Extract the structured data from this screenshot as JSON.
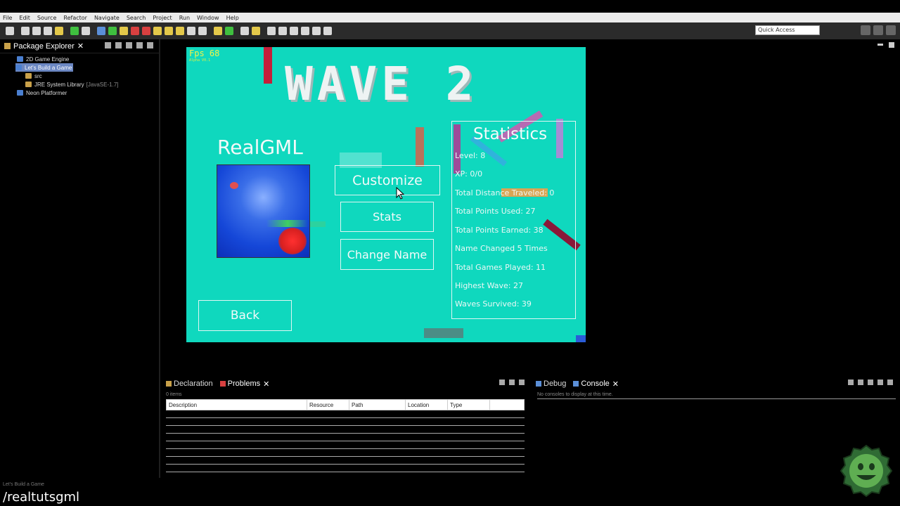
{
  "menubar": {
    "items": [
      "File",
      "Edit",
      "Source",
      "Refactor",
      "Navigate",
      "Search",
      "Project",
      "Run",
      "Window",
      "Help"
    ]
  },
  "toolbar": {
    "quick_access_placeholder": "Quick Access"
  },
  "package_explorer": {
    "title": "Package Explorer",
    "items": [
      {
        "label": "2D Game Engine",
        "icon": "project-icon"
      },
      {
        "label": "Let's Build a Game",
        "icon": "project-icon",
        "selected": true
      },
      {
        "label": "src",
        "icon": "package-folder-icon"
      },
      {
        "label": "JRE System Library",
        "sub": "[JavaSE-1.7]",
        "icon": "library-icon"
      },
      {
        "label": "Neon Platformer",
        "icon": "project-icon"
      }
    ]
  },
  "game": {
    "fps": "Fps 68",
    "fps_sub": "Alpha V0.1",
    "wave_title": "WAVE 2",
    "player_name": "RealGML",
    "buttons": {
      "customize": "Customize",
      "stats": "Stats",
      "change_name": "Change Name",
      "back": "Back"
    },
    "stats": {
      "title": "Statistics",
      "lines": [
        "Level: 8",
        "XP: 0/0",
        "Total Distance Traveled: 0",
        "Total Points Used: 27",
        "Total Points Earned: 38",
        "Name Changed 5 Times",
        "Total Games Played: 11",
        "Highest Wave: 27",
        "Waves Survived: 39"
      ]
    },
    "colors": {
      "background": "#0fd8be",
      "fps": "#f2f24a",
      "avatar": "#1547d8"
    }
  },
  "problems_panel": {
    "tabs": [
      "Declaration",
      "Problems"
    ],
    "count": "0 items",
    "columns": [
      "Description",
      "Resource",
      "Path",
      "Location",
      "Type"
    ]
  },
  "console_panel": {
    "tabs": [
      "Debug",
      "Console"
    ],
    "message": "No consoles to display at this time."
  },
  "status_bar": {
    "text": "Let's Build a Game"
  },
  "watermark": "/realtutsgml"
}
